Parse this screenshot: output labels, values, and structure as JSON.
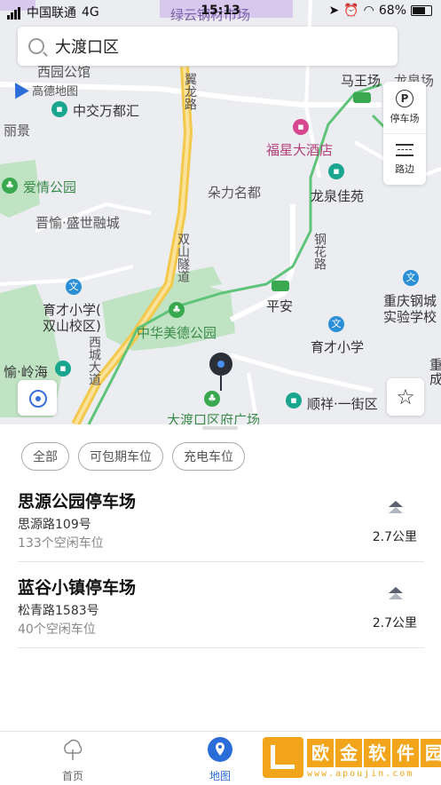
{
  "status": {
    "carrier": "中国联通",
    "network": "4G",
    "time": "15:13",
    "battery": "68%"
  },
  "search": {
    "text": "大渡口区"
  },
  "map": {
    "labels": {
      "top_market": "绿云钢材市场",
      "gaode": "高德地图",
      "xiyuan": "西园公馆",
      "zhongjiao": "中交万都汇",
      "lijing": "丽景",
      "aiqing": "爱情公园",
      "jinyu": "晋愉·盛世融城",
      "duoli": "朵力名都",
      "fuxing": "福星大酒店",
      "longquan": "龙泉佳苑",
      "mawang": "马王场",
      "longquanchang": "龙泉场",
      "yucai_school": "育才小学(双山校区)",
      "yucai_school_l1": "育才小学(",
      "yucai_school_l2": "双山校区)",
      "zhonghua": "中华美德公园",
      "pingan": "平安",
      "yucai": "育才小学",
      "chongqing_school_l1": "重庆钢城",
      "chongqing_school_l2": "实验学校",
      "shunxiang": "顺祥·一街区",
      "dadukou_square": "大渡口区府广场",
      "yuling": "愉·岭海",
      "chong": "重",
      "cheng": "成",
      "road_yilong": "翼龙路",
      "road_shuangshan": "双山隧道",
      "road_xicheng": "西城大道",
      "road_ganghua": "钢花路"
    }
  },
  "side_panel": {
    "parking": "停车场",
    "roadside": "路边"
  },
  "filters": [
    "全部",
    "可包期车位",
    "充电车位"
  ],
  "list": [
    {
      "name": "思源公园停车场",
      "address": "思源路109号",
      "slots": "133个空闲车位",
      "distance": "2.7公里"
    },
    {
      "name": "蓝谷小镇停车场",
      "address": "松青路1583号",
      "slots": "40个空闲车位",
      "distance": "2.7公里"
    }
  ],
  "tabs": [
    {
      "label": "首页"
    },
    {
      "label": "地图"
    }
  ],
  "watermark": {
    "text": [
      "欧",
      "金",
      "软",
      "件",
      "园"
    ],
    "url": "www.apoujin.com"
  }
}
